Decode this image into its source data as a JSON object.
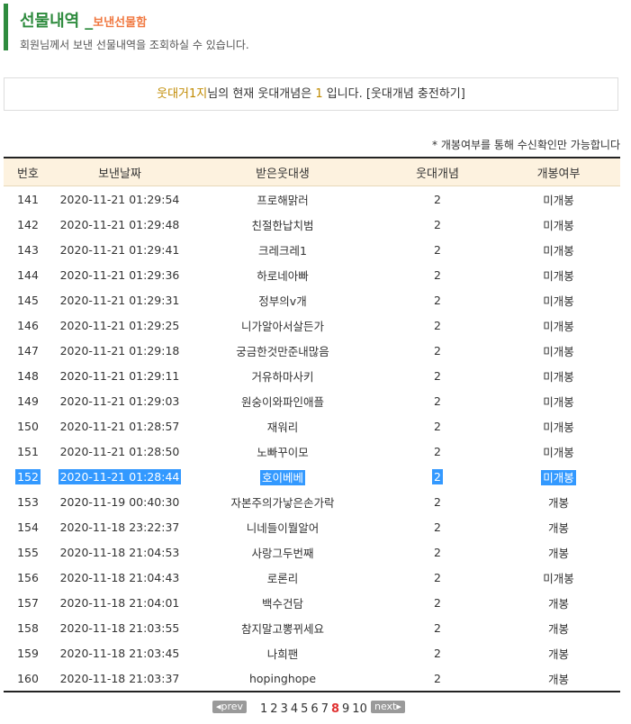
{
  "header": {
    "title": "선물내역",
    "dash": "_",
    "subtitle": "보낸선물함",
    "description": "회원님께서 보낸 선물내역을 조회하실 수 있습니다."
  },
  "info": {
    "nickname": "웃대거1지",
    "text_a": "님의 현재 웃대개념은 ",
    "count": "1",
    "text_b": " 입니다. ",
    "charge_link": "[웃대개념 충전하기]"
  },
  "notice": "* 개봉여부를 통해 수신확인만 가능합니다",
  "table": {
    "columns": [
      "번호",
      "보낸날짜",
      "받은웃대생",
      "웃대개념",
      "개봉여부"
    ],
    "rows": [
      {
        "no": "141",
        "date": "2020-11-21 01:29:54",
        "recipient": "프로해맑러",
        "count": "2",
        "status": "미개봉"
      },
      {
        "no": "142",
        "date": "2020-11-21 01:29:48",
        "recipient": "친절한납치범",
        "count": "2",
        "status": "미개봉"
      },
      {
        "no": "143",
        "date": "2020-11-21 01:29:41",
        "recipient": "크레크레1",
        "count": "2",
        "status": "미개봉"
      },
      {
        "no": "144",
        "date": "2020-11-21 01:29:36",
        "recipient": "하로네아빠",
        "count": "2",
        "status": "미개봉"
      },
      {
        "no": "145",
        "date": "2020-11-21 01:29:31",
        "recipient": "정부의v개",
        "count": "2",
        "status": "미개봉"
      },
      {
        "no": "146",
        "date": "2020-11-21 01:29:25",
        "recipient": "니가알아서살든가",
        "count": "2",
        "status": "미개봉"
      },
      {
        "no": "147",
        "date": "2020-11-21 01:29:18",
        "recipient": "궁금한것만준내많음",
        "count": "2",
        "status": "미개봉"
      },
      {
        "no": "148",
        "date": "2020-11-21 01:29:11",
        "recipient": "거유하마사키",
        "count": "2",
        "status": "미개봉"
      },
      {
        "no": "149",
        "date": "2020-11-21 01:29:03",
        "recipient": "원숭이와파인애플",
        "count": "2",
        "status": "미개봉"
      },
      {
        "no": "150",
        "date": "2020-11-21 01:28:57",
        "recipient": "재워리",
        "count": "2",
        "status": "미개봉"
      },
      {
        "no": "151",
        "date": "2020-11-21 01:28:50",
        "recipient": "노빠꾸이모",
        "count": "2",
        "status": "미개봉"
      },
      {
        "no": "152",
        "date": "2020-11-21 01:28:44",
        "recipient": "호이베베",
        "count": "2",
        "status": "미개봉",
        "selected": true
      },
      {
        "no": "153",
        "date": "2020-11-19 00:40:30",
        "recipient": "자본주의가낳은손가락",
        "count": "2",
        "status": "개봉"
      },
      {
        "no": "154",
        "date": "2020-11-18 23:22:37",
        "recipient": "니네들이뭘알어",
        "count": "2",
        "status": "개봉"
      },
      {
        "no": "155",
        "date": "2020-11-18 21:04:53",
        "recipient": "사랑그두번째",
        "count": "2",
        "status": "개봉"
      },
      {
        "no": "156",
        "date": "2020-11-18 21:04:43",
        "recipient": "로론리",
        "count": "2",
        "status": "미개봉"
      },
      {
        "no": "157",
        "date": "2020-11-18 21:04:01",
        "recipient": "백수건담",
        "count": "2",
        "status": "개봉"
      },
      {
        "no": "158",
        "date": "2020-11-18 21:03:55",
        "recipient": "참지말고뽕뀌세요",
        "count": "2",
        "status": "개봉"
      },
      {
        "no": "159",
        "date": "2020-11-18 21:03:45",
        "recipient": "나희팬",
        "count": "2",
        "status": "개봉"
      },
      {
        "no": "160",
        "date": "2020-11-18 21:03:37",
        "recipient": "hopinghope",
        "count": "2",
        "status": "개봉"
      }
    ]
  },
  "pagination": {
    "prev": "◂prev",
    "next": "next▸",
    "pages": [
      "1",
      "2",
      "3",
      "4",
      "5",
      "6",
      "7",
      "8",
      "9",
      "10"
    ],
    "current": "8"
  },
  "colors": {
    "accent": "#2e8b3e",
    "subtitle": "#f07840",
    "header_bg": "#fdf2df",
    "selection": "#3399ff",
    "current_page": "#e03030"
  }
}
